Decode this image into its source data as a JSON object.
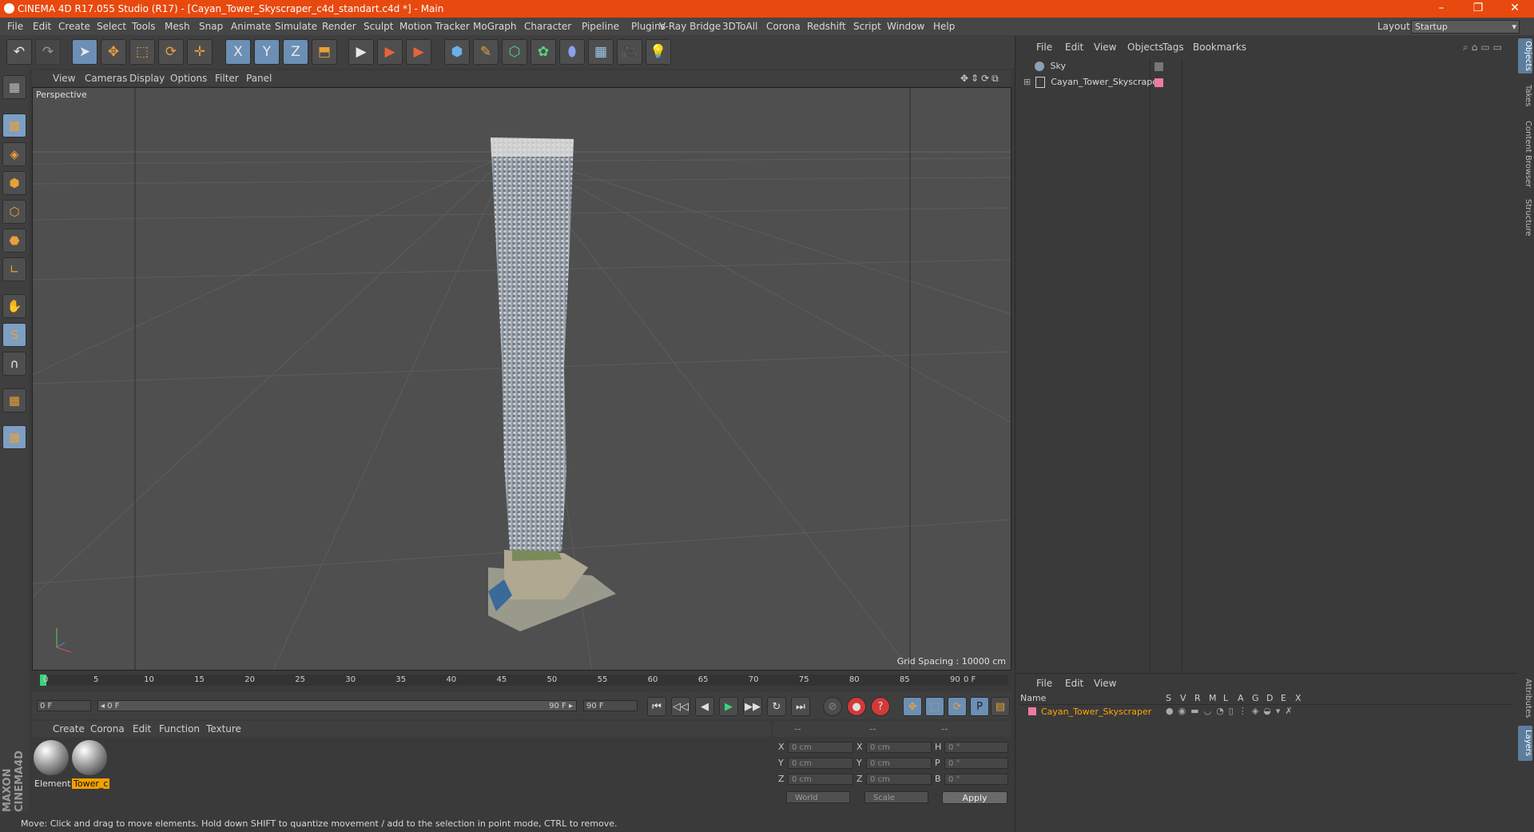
{
  "window": {
    "title": "CINEMA 4D R17.055 Studio (R17) - [Cayan_Tower_Skyscraper_c4d_standart.c4d *] - Main",
    "minimize": "–",
    "restore": "❐",
    "close": "✕"
  },
  "menu": [
    "File",
    "Edit",
    "Create",
    "Select",
    "Tools",
    "Mesh",
    "Snap",
    "Animate",
    "Simulate",
    "Render",
    "Sculpt",
    "Motion Tracker",
    "MoGraph",
    "Character",
    "Pipeline",
    "Plugins",
    "V-Ray Bridge",
    "3DToAll",
    "Corona",
    "Redshift",
    "Script",
    "Window",
    "Help"
  ],
  "layout": {
    "label": "Layout:",
    "value": "Startup"
  },
  "toolbar": {
    "undo": "↶",
    "redo": "↷",
    "select": "➤",
    "move": "✥",
    "scale": "⬚",
    "rotate": "⟳",
    "transform": "✛",
    "x": "X",
    "y": "Y",
    "z": "Z",
    "coord": "⬒",
    "render_view": "▶",
    "render_pic": "▶",
    "render_settings": "▶",
    "cube": "⬢",
    "pen": "✎",
    "subdiv": "⬡",
    "cloner": "✿",
    "deformer": "⬮",
    "floor": "▦",
    "camera": "🎥",
    "light": "💡"
  },
  "left_tools": [
    "▦",
    "▩",
    "◈",
    "⬢",
    "⬡",
    "⬣",
    "∟",
    "✋",
    "S",
    "∩",
    "▦",
    "▦"
  ],
  "viewport": {
    "menu": [
      "View",
      "Cameras",
      "Display",
      "Options",
      "Filter",
      "Panel"
    ],
    "label": "Perspective",
    "grid_spacing": "Grid Spacing : 10000 cm"
  },
  "timeline": {
    "ticks": [
      "0",
      "5",
      "10",
      "15",
      "20",
      "25",
      "30",
      "35",
      "40",
      "45",
      "50",
      "55",
      "60",
      "65",
      "70",
      "75",
      "80",
      "85",
      "90"
    ],
    "frame_current": "0 F",
    "start": "0 F",
    "slider_left": "◂ 0 F",
    "slider_right": "90 F ▸",
    "end": "90 F",
    "controls": [
      "⏮",
      "◁◁",
      "◀",
      "▶",
      "▶▶",
      "↻",
      "⏭"
    ]
  },
  "materials": {
    "menu": [
      "Create",
      "Corona",
      "Edit",
      "Function",
      "Texture"
    ],
    "items": [
      {
        "name": "Element"
      },
      {
        "name": "Tower_c"
      }
    ]
  },
  "coords": {
    "head": [
      "--",
      "--",
      "--"
    ],
    "rows": [
      {
        "a": "X",
        "av": "0 cm",
        "b": "X",
        "bv": "0 cm",
        "c": "H",
        "cv": "0 °"
      },
      {
        "a": "Y",
        "av": "0 cm",
        "b": "Y",
        "bv": "0 cm",
        "c": "P",
        "cv": "0 °"
      },
      {
        "a": "Z",
        "av": "0 cm",
        "b": "Z",
        "bv": "0 cm",
        "c": "B",
        "cv": "0 °"
      }
    ],
    "space": "World",
    "mode": "Scale",
    "apply": "Apply"
  },
  "status": "Move: Click and drag to move elements. Hold down SHIFT to quantize movement / add to the selection in point mode, CTRL to remove.",
  "objects": {
    "menu": [
      "File",
      "Edit",
      "View",
      "Objects",
      "Tags",
      "Bookmarks"
    ],
    "items": [
      {
        "name": "Sky",
        "color": "#8aa0b8"
      },
      {
        "name": "Cayan_Tower_Skyscraper",
        "color": "#f07aa0"
      }
    ]
  },
  "layers": {
    "menu": [
      "File",
      "Edit",
      "View"
    ],
    "columns": [
      "Name",
      "S",
      "V",
      "R",
      "M",
      "L",
      "A",
      "G",
      "D",
      "E",
      "X"
    ],
    "items": [
      {
        "name": "Cayan_Tower_Skyscraper",
        "color": "#f07aa0"
      }
    ]
  },
  "right_tabs": [
    "Objects",
    "Takes",
    "Content Browser",
    "Structure",
    "Attributes",
    "Layers"
  ],
  "colors": {
    "title_bar": "#e8490f",
    "accent": "#6b8fb5",
    "selected_text": "#ffa500"
  }
}
